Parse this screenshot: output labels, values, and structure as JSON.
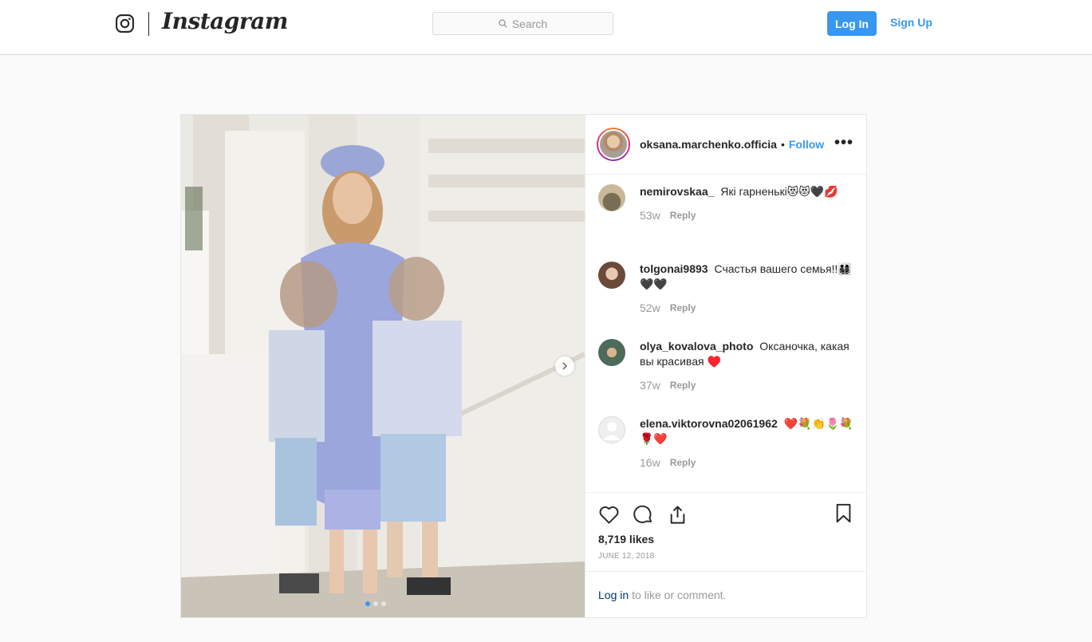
{
  "header": {
    "logo_icon": "instagram-camera-icon",
    "wordmark": "Instagram",
    "search_placeholder": "Search",
    "login_label": "Log In",
    "signup_label": "Sign Up"
  },
  "post": {
    "username": "oksana.marchenko.officia",
    "separator": "•",
    "follow_label": "Follow",
    "more_icon": "more-options-icon",
    "more_label": "•••",
    "likes": "8,719 likes",
    "date": "JUNE 12, 2018",
    "login_link": "Log in",
    "login_prompt": "to like or comment.",
    "carousel": {
      "slides": 3,
      "active": 0
    }
  },
  "comments": [
    {
      "user": "nemirovskaa_",
      "text": "Які гарненькі😻😻🖤💋",
      "age": "53w",
      "reply": "Reply"
    },
    {
      "user": "tolgonai9893",
      "text": "Счастья вашего семья!!👨‍👩‍👧‍👦🖤🖤",
      "age": "52w",
      "reply": "Reply"
    },
    {
      "user": "olya_kovalova_photo",
      "text": "Оксаночка, какая вы красивая ♥️",
      "age": "37w",
      "reply": "Reply"
    },
    {
      "user": "elena.viktorovna02061962",
      "text": "❤️💐👏🌷💐🌹❤️",
      "age": "16w",
      "reply": "Reply"
    }
  ],
  "colors": {
    "accent": "#3897f0",
    "border": "#dbdbdb",
    "background": "#fafafa"
  }
}
